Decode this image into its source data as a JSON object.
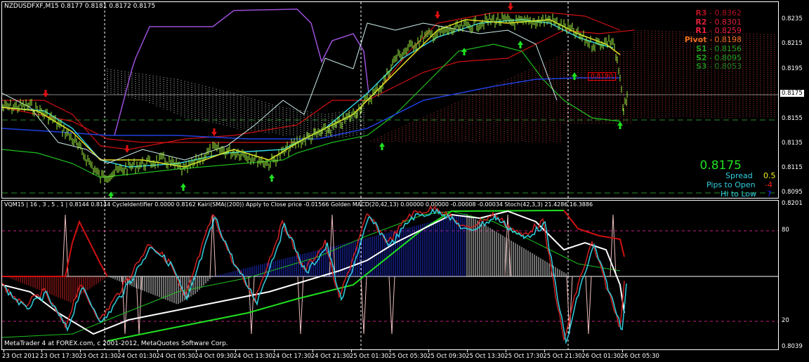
{
  "chart": {
    "symbol_header": "NZDUSDFXF,M15  0.8177 0.8181 0.8172 0.8175",
    "price_axis": [
      "0.8235",
      "0.8215",
      "0.8195",
      "0.8175",
      "0.8155",
      "0.8135",
      "0.8115",
      "0.8095"
    ],
    "current_price_label": "0.8175",
    "level_label": "0.8190",
    "pivots": [
      {
        "name": "R3",
        "value": "0.8362",
        "color": "#b01020"
      },
      {
        "name": "R2",
        "value": "0.8301",
        "color": "#e0203a"
      },
      {
        "name": "R1",
        "value": "0.8259",
        "color": "#f02040"
      },
      {
        "name": "Pivot",
        "value": "0.8198",
        "color": "#f07020"
      },
      {
        "name": "S1",
        "value": "0.8156",
        "color": "#20a020"
      },
      {
        "name": "S2",
        "value": "0.8095",
        "color": "#20a020"
      },
      {
        "name": "S3",
        "value": "0.8053",
        "color": "#208020"
      }
    ],
    "separator": " - ",
    "info": {
      "price": "0.8175",
      "spread_label": "Spread",
      "spread_value": "0.5",
      "pips_label": "Pips to Open",
      "pips_value": "-4",
      "hilo_label": "Hi to Low",
      "hilo_value": "7"
    }
  },
  "indicator": {
    "header": "VQM15 | 16 , 3 , 5 , 1 |  0.8144 0.8144  CycleIdentifier 0.0000 0.8162  Kairi(SMA((200)) Apply to Close price -0.01566  Golden MACD(20,42,13) 0.00000 0.00000 -0.00008 -0.00034  Stoch(42,3,3) 21.4286 16.3886",
    "axis": [
      "0.8201",
      "80",
      "20",
      "0.8039"
    ]
  },
  "copyright": "MetaTrader 4 at FOREX.com, c 2001-2012, MetaQuotes Software Corp.",
  "time_axis": [
    "23 Oct 2012",
    "23 Oct 17:30",
    "23 Oct 21:30",
    "24 Oct 01:30",
    "24 Oct 05:30",
    "24 Oct 09:30",
    "24 Oct 13:30",
    "24 Oct 17:30",
    "24 Oct 21:30",
    "25 Oct 01:30",
    "25 Oct 05:30",
    "25 Oct 09:30",
    "25 Oct 13:30",
    "25 Oct 17:30",
    "25 Oct 21:30",
    "26 Oct 01:30",
    "26 Oct 05:30"
  ]
}
